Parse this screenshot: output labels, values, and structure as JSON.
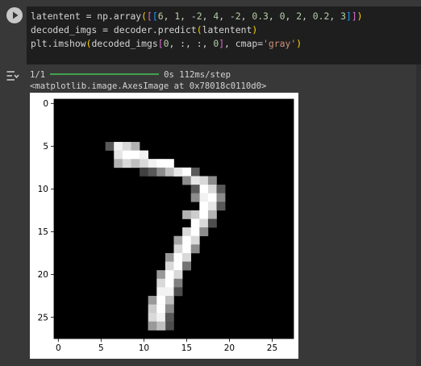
{
  "code_cell": {
    "run_button_icon": "play-icon",
    "lines": [
      [
        {
          "t": "latentent = np.array",
          "c": ""
        },
        {
          "t": "(",
          "c": "b1"
        },
        {
          "t": "[",
          "c": "b2"
        },
        {
          "t": "[",
          "c": "b3"
        },
        {
          "t": "6",
          "c": "num"
        },
        {
          "t": ", ",
          "c": ""
        },
        {
          "t": "1",
          "c": "num"
        },
        {
          "t": ", -",
          "c": ""
        },
        {
          "t": "2",
          "c": "num"
        },
        {
          "t": ", ",
          "c": ""
        },
        {
          "t": "4",
          "c": "num"
        },
        {
          "t": ", -",
          "c": ""
        },
        {
          "t": "2",
          "c": "num"
        },
        {
          "t": ", ",
          "c": ""
        },
        {
          "t": "0.3",
          "c": "num"
        },
        {
          "t": ", ",
          "c": ""
        },
        {
          "t": "0",
          "c": "num"
        },
        {
          "t": ", ",
          "c": ""
        },
        {
          "t": "2",
          "c": "num"
        },
        {
          "t": ", ",
          "c": ""
        },
        {
          "t": "0.2",
          "c": "num"
        },
        {
          "t": ", ",
          "c": ""
        },
        {
          "t": "3",
          "c": "num"
        },
        {
          "t": "]",
          "c": "b3"
        },
        {
          "t": "]",
          "c": "b2"
        },
        {
          "t": ")",
          "c": "b1"
        }
      ],
      [
        {
          "t": "decoded_imgs = decoder.predict",
          "c": ""
        },
        {
          "t": "(",
          "c": "b1"
        },
        {
          "t": "latentent",
          "c": ""
        },
        {
          "t": ")",
          "c": "b1"
        }
      ],
      [
        {
          "t": "plt.imshow",
          "c": ""
        },
        {
          "t": "(",
          "c": "b1"
        },
        {
          "t": "decoded_imgs",
          "c": ""
        },
        {
          "t": "[",
          "c": "b2"
        },
        {
          "t": "0",
          "c": "num"
        },
        {
          "t": ", :, :, ",
          "c": ""
        },
        {
          "t": "0",
          "c": "num"
        },
        {
          "t": "]",
          "c": "b2"
        },
        {
          "t": ", cmap=",
          "c": ""
        },
        {
          "t": "'gray'",
          "c": "str"
        },
        {
          "t": ")",
          "c": "b1"
        }
      ]
    ]
  },
  "output": {
    "toggle_icon": "output-toggle-icon",
    "progress_prefix": "1/1",
    "progress_fraction": 1.0,
    "progress_suffix": "0s 112ms/step",
    "repr_text": "<matplotlib.image.AxesImage at 0x78018c0110d0>"
  },
  "image_plot": {
    "colormap": "gray",
    "xlim": [
      -0.5,
      27.5
    ],
    "ylim_inverted": [
      27.5,
      -0.5
    ],
    "x_ticks": [
      0,
      5,
      10,
      15,
      20,
      25
    ],
    "y_ticks": [
      0,
      5,
      10,
      15,
      20,
      25
    ],
    "x_tick_labels": [
      "0",
      "5",
      "10",
      "15",
      "20",
      "25"
    ],
    "y_tick_labels": [
      "0",
      "5",
      "10",
      "15",
      "20",
      "25"
    ],
    "pixels": [
      [
        6,
        0.35
      ],
      [
        7,
        0.95
      ],
      [
        8,
        0.85
      ],
      [
        9,
        0.7
      ],
      [
        10,
        0.45
      ],
      [
        7,
        0.9
      ],
      [
        8,
        1
      ],
      [
        9,
        1
      ],
      [
        10,
        0.95
      ],
      [
        11,
        0.8
      ],
      [
        12,
        0.55
      ],
      [
        13,
        0.35
      ],
      [
        7,
        0.7
      ],
      [
        8,
        0.85
      ],
      [
        9,
        0.75
      ],
      [
        10,
        0.85
      ],
      [
        11,
        0.95
      ],
      [
        12,
        1
      ],
      [
        13,
        1
      ],
      [
        14,
        0.95
      ],
      [
        15,
        0.75
      ],
      [
        16,
        0.35
      ],
      [
        10,
        0.25
      ],
      [
        11,
        0.35
      ],
      [
        12,
        0.55
      ],
      [
        13,
        0.75
      ],
      [
        14,
        0.9
      ],
      [
        15,
        1
      ],
      [
        16,
        1
      ],
      [
        17,
        0.85
      ],
      [
        18,
        0.55
      ],
      [
        15,
        0.55
      ],
      [
        16,
        0.9
      ],
      [
        17,
        1
      ],
      [
        18,
        0.85
      ],
      [
        19,
        0.35
      ],
      [
        16,
        0.35
      ],
      [
        17,
        0.95
      ],
      [
        18,
        1
      ],
      [
        19,
        0.55
      ],
      [
        16,
        0.55
      ],
      [
        17,
        1
      ],
      [
        18,
        0.9
      ],
      [
        19,
        0.35
      ],
      [
        16,
        0.8
      ],
      [
        17,
        1
      ],
      [
        18,
        0.7
      ],
      [
        15,
        0.7
      ],
      [
        16,
        1
      ],
      [
        17,
        0.85
      ],
      [
        18,
        0.3
      ],
      [
        15,
        0.85
      ],
      [
        16,
        1
      ],
      [
        17,
        0.55
      ],
      [
        14,
        0.65
      ],
      [
        15,
        1
      ],
      [
        16,
        0.85
      ],
      [
        14,
        0.85
      ],
      [
        15,
        1
      ],
      [
        16,
        0.55
      ],
      [
        13,
        0.6
      ],
      [
        14,
        1
      ],
      [
        15,
        0.85
      ],
      [
        13,
        0.85
      ],
      [
        14,
        1
      ],
      [
        15,
        0.45
      ],
      [
        12,
        0.6
      ],
      [
        13,
        1
      ],
      [
        14,
        0.85
      ],
      [
        12,
        0.85
      ],
      [
        13,
        1
      ],
      [
        14,
        0.5
      ],
      [
        12,
        0.95
      ],
      [
        13,
        0.95
      ],
      [
        14,
        0.3
      ],
      [
        11,
        0.6
      ],
      [
        12,
        1
      ],
      [
        13,
        0.75
      ],
      [
        11,
        0.8
      ],
      [
        12,
        1
      ],
      [
        13,
        0.55
      ],
      [
        11,
        0.85
      ],
      [
        12,
        0.95
      ],
      [
        13,
        0.35
      ],
      [
        11,
        0.85
      ],
      [
        12,
        0.9
      ],
      [
        13,
        0.3
      ],
      [
        11,
        0.6
      ],
      [
        12,
        0.75
      ]
    ]
  }
}
